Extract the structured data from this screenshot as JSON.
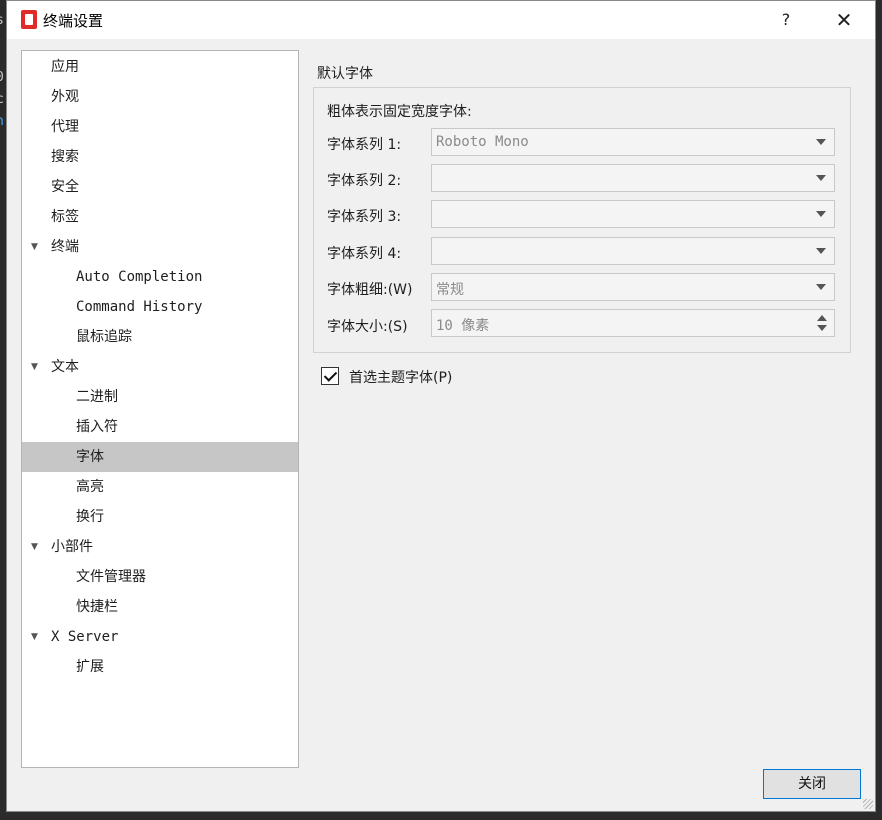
{
  "background_text": [
    "s",
    "0",
    "c",
    "n"
  ],
  "window": {
    "title": "终端设置",
    "help_label": "?",
    "close_glyph": "✕",
    "icon": "app-book-icon"
  },
  "tree": {
    "items": [
      {
        "label": "应用",
        "level": 0,
        "expandable": false
      },
      {
        "label": "外观",
        "level": 0,
        "expandable": false
      },
      {
        "label": "代理",
        "level": 0,
        "expandable": false
      },
      {
        "label": "搜索",
        "level": 0,
        "expandable": false
      },
      {
        "label": "安全",
        "level": 0,
        "expandable": false
      },
      {
        "label": "标签",
        "level": 0,
        "expandable": false
      },
      {
        "label": "终端",
        "level": 0,
        "expandable": true
      },
      {
        "label": "Auto Completion",
        "level": 1,
        "expandable": false
      },
      {
        "label": "Command History",
        "level": 1,
        "expandable": false
      },
      {
        "label": "鼠标追踪",
        "level": 1,
        "expandable": false
      },
      {
        "label": "文本",
        "level": 0,
        "expandable": true
      },
      {
        "label": "二进制",
        "level": 1,
        "expandable": false
      },
      {
        "label": "插入符",
        "level": 1,
        "expandable": false
      },
      {
        "label": "字体",
        "level": 1,
        "expandable": false,
        "selected": true
      },
      {
        "label": "高亮",
        "level": 1,
        "expandable": false
      },
      {
        "label": "换行",
        "level": 1,
        "expandable": false
      },
      {
        "label": "小部件",
        "level": 0,
        "expandable": true
      },
      {
        "label": "文件管理器",
        "level": 1,
        "expandable": false
      },
      {
        "label": "快捷栏",
        "level": 1,
        "expandable": false
      },
      {
        "label": "X Server",
        "level": 0,
        "expandable": true
      },
      {
        "label": "扩展",
        "level": 1,
        "expandable": false
      }
    ]
  },
  "font_group": {
    "title": "默认字体",
    "subtitle": "粗体表示固定宽度字体:",
    "family1": {
      "label": "字体系列 1:",
      "value": "Roboto Mono"
    },
    "family2": {
      "label": "字体系列 2:",
      "value": ""
    },
    "family3": {
      "label": "字体系列 3:",
      "value": ""
    },
    "family4": {
      "label": "字体系列 4:",
      "value": ""
    },
    "weight": {
      "label": "字体粗细:(W)",
      "value": "常规"
    },
    "size": {
      "label": "字体大小:(S)",
      "value": "10 像素"
    }
  },
  "prefer_theme_font": {
    "label": "首选主题字体(P)",
    "checked": true
  },
  "buttons": {
    "close": "关闭"
  }
}
